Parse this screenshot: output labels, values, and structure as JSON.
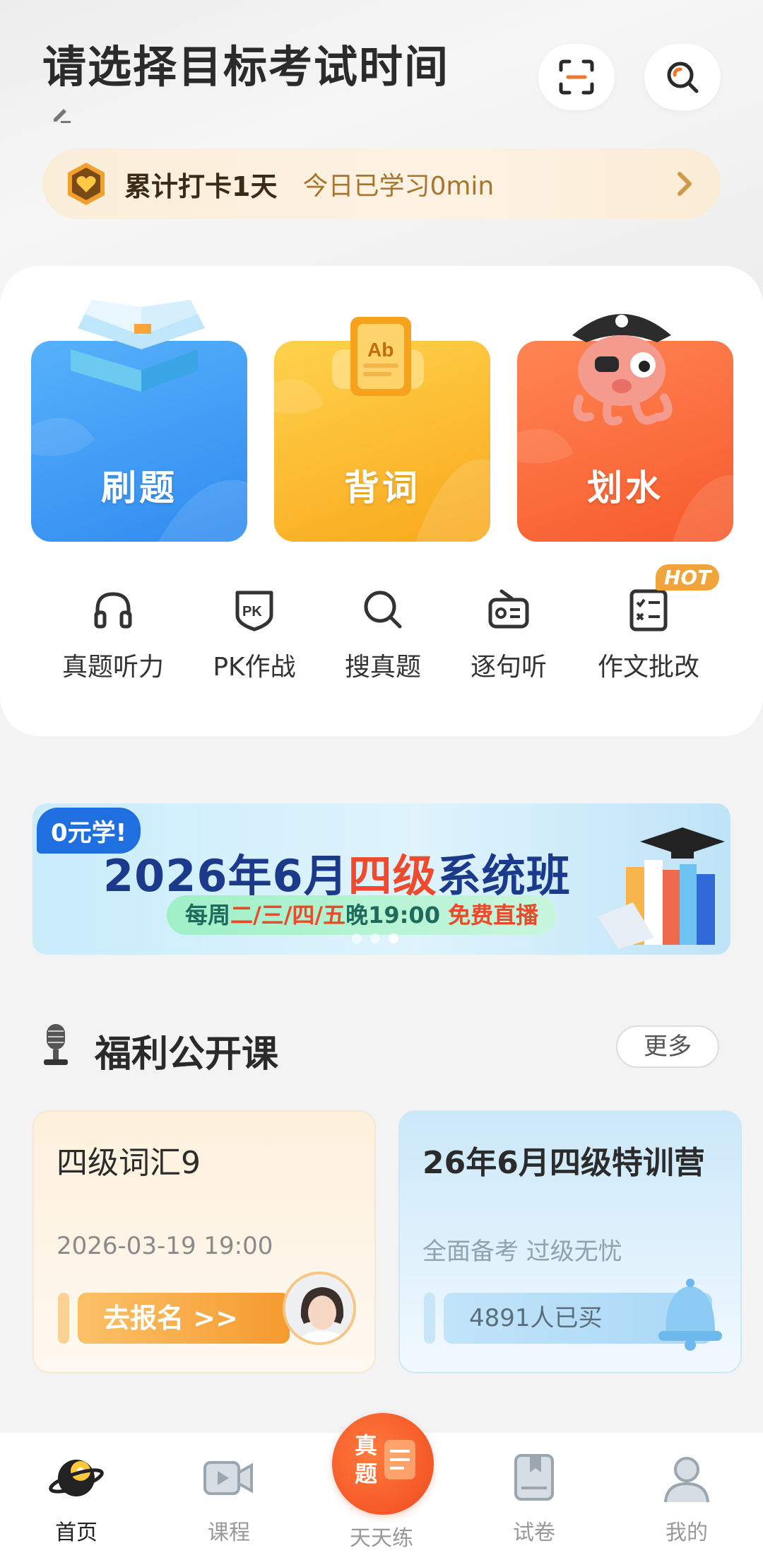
{
  "header": {
    "title": "请选择目标考试时间"
  },
  "checkin": {
    "days_text": "累计打卡1天",
    "today_text": "今日已学习0min"
  },
  "big_cards": [
    {
      "label": "刷题",
      "color": "#3f9bf3"
    },
    {
      "label": "背词",
      "color": "#fbbf2e"
    },
    {
      "label": "划水",
      "color": "#fb6a3c"
    }
  ],
  "tools": [
    {
      "label": "真题听力",
      "icon": "headphones-icon"
    },
    {
      "label": "PK作战",
      "icon": "pk-shield-icon"
    },
    {
      "label": "搜真题",
      "icon": "search-icon"
    },
    {
      "label": "逐句听",
      "icon": "radio-icon"
    },
    {
      "label": "作文批改",
      "icon": "checklist-icon",
      "badge": "HOT"
    }
  ],
  "banner": {
    "tag": "0元学!",
    "headline_pre": "2026年6月",
    "headline_hl": "四级",
    "headline_post": "系统班",
    "sub_pre": "每周",
    "sub_days": "二/三/四/五",
    "sub_time": "晚19:00",
    "sub_free": "免费直播"
  },
  "section": {
    "title": "福利公开课",
    "more": "更多"
  },
  "courses": [
    {
      "title": "四级词汇9",
      "date": "2026-03-19 19:00",
      "action": "去报名 >>"
    },
    {
      "title": "26年6月四级特训营",
      "tags": "全面备考  过级无忧",
      "bought": "4891人已买"
    }
  ],
  "tabbar": {
    "items": [
      "首页",
      "课程",
      "天天练",
      "试卷",
      "我的"
    ],
    "center_icon_text": "真题",
    "active_color": "#222222",
    "inactive_color": "#999999"
  }
}
